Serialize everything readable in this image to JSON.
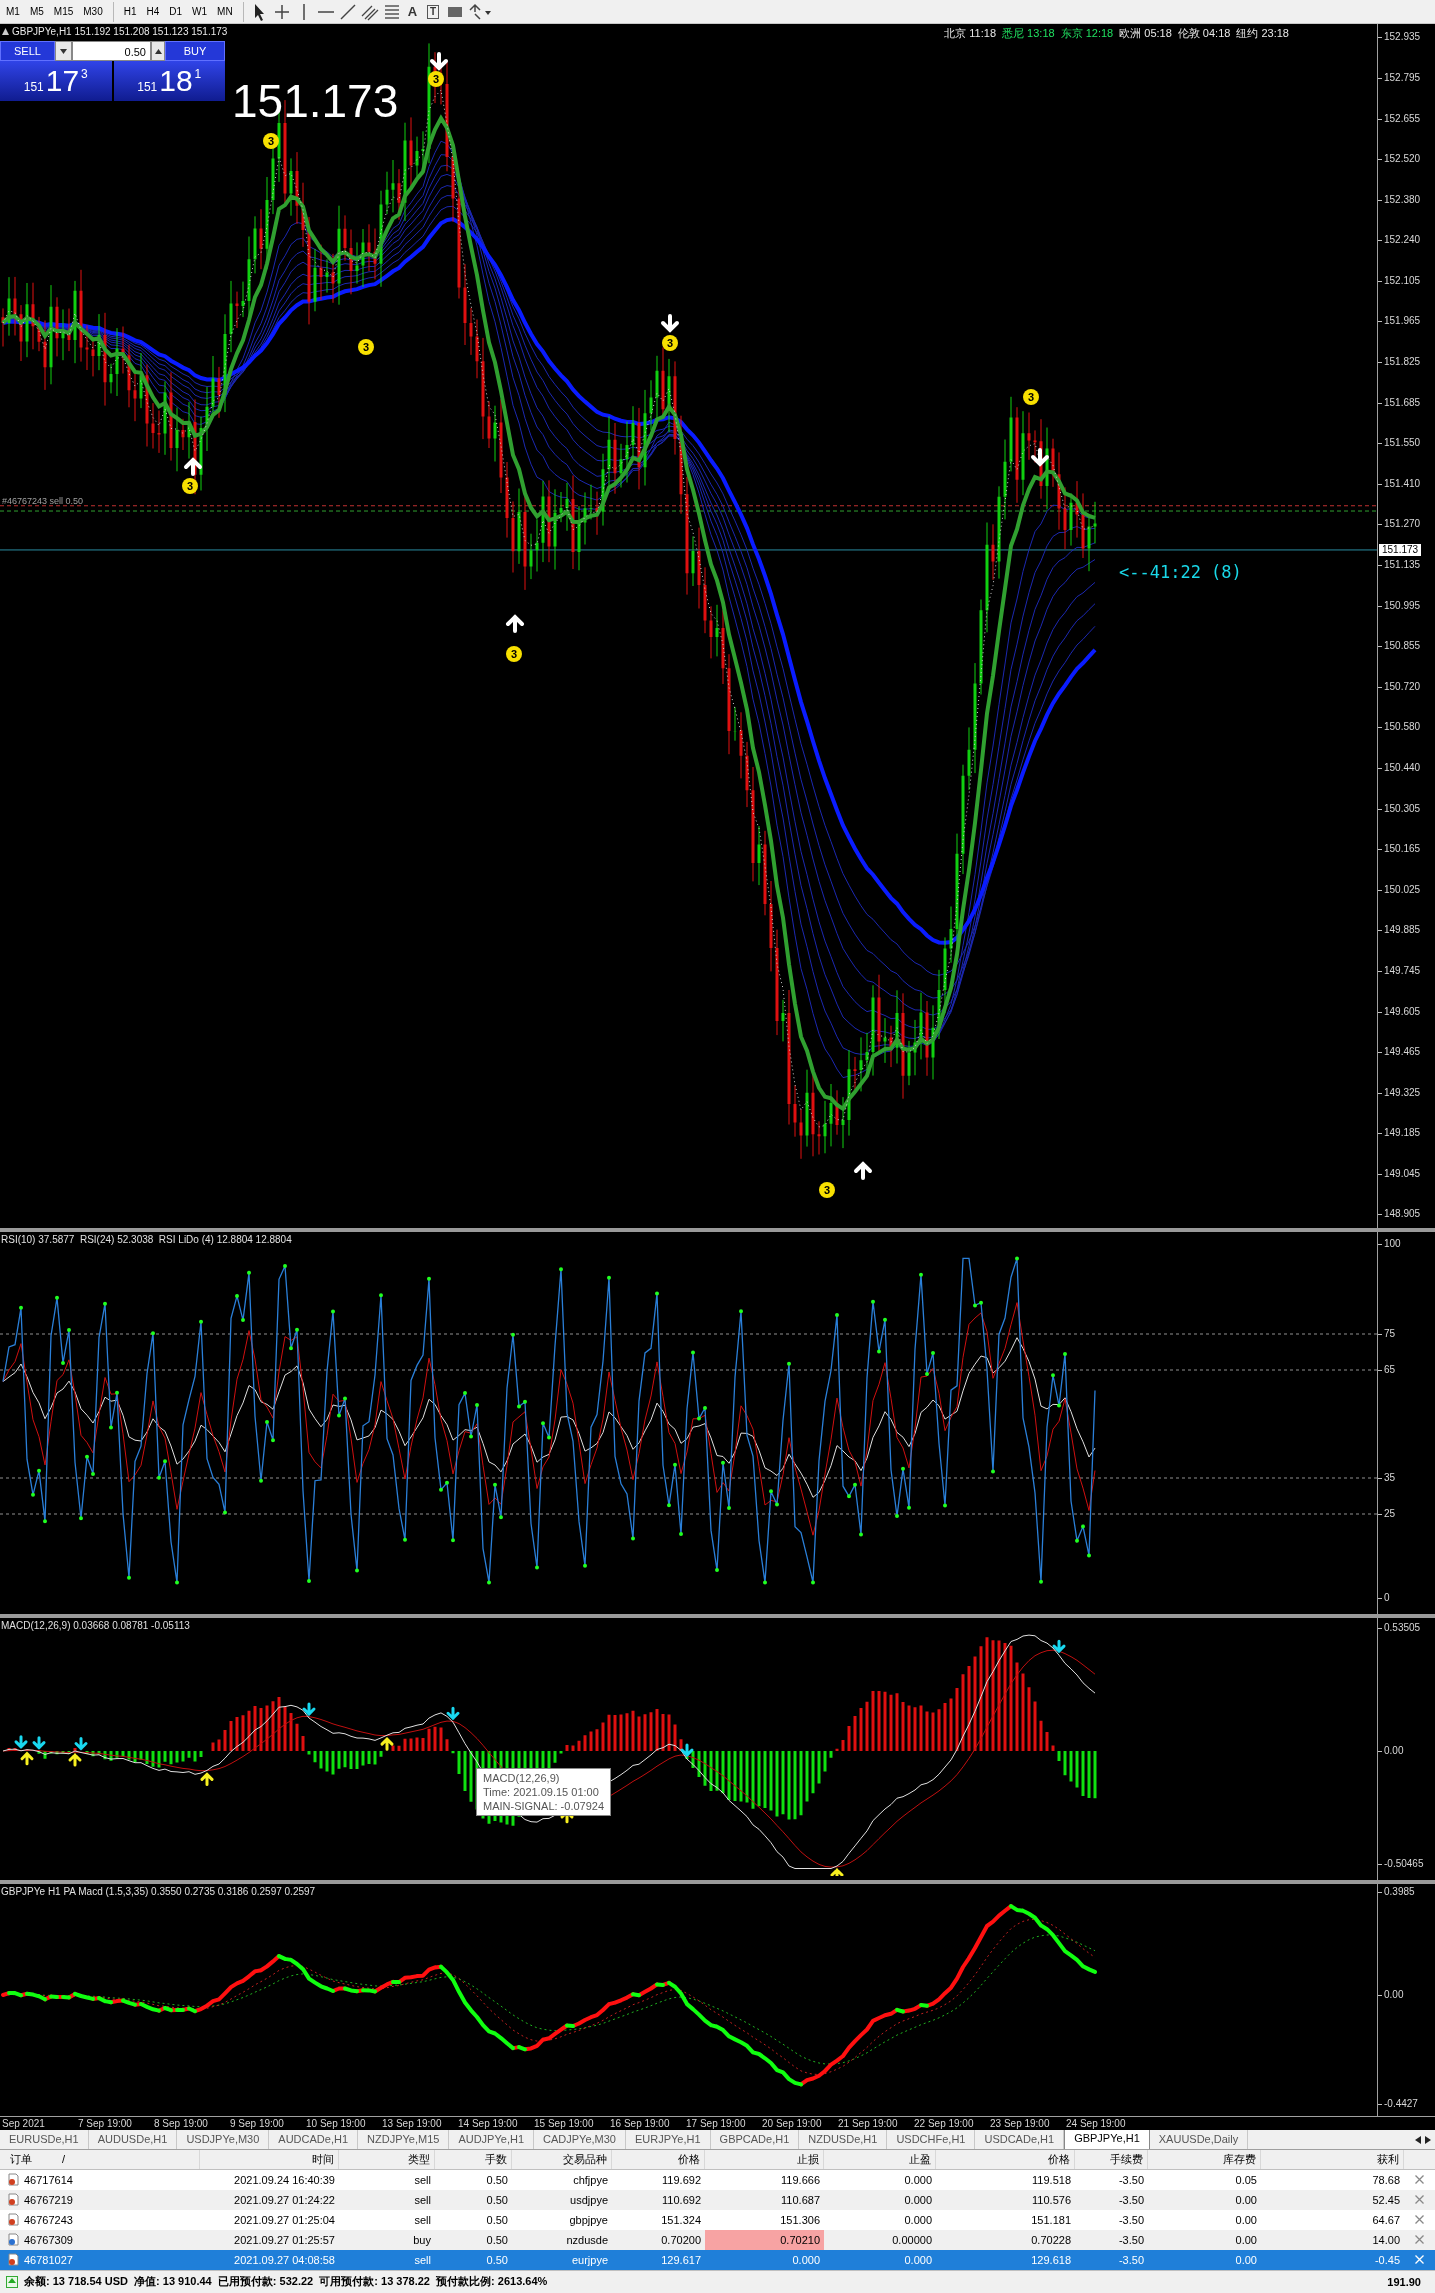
{
  "toolbar": {
    "timeframes": [
      "M1",
      "M5",
      "M15",
      "M30",
      "H1",
      "H4",
      "D1",
      "W1",
      "MN"
    ],
    "text_tool": "A",
    "label_tool": "T"
  },
  "chart": {
    "symbol_line": "GBPJPYe,H1 151.192 151.208 151.123 151.173",
    "clocks": [
      {
        "city": "北京",
        "time": "11:18",
        "market_open": false
      },
      {
        "city": "悉尼",
        "time": "13:18",
        "market_open": true
      },
      {
        "city": "东京",
        "time": "12:18",
        "market_open": true
      },
      {
        "city": "欧洲",
        "time": "05:18",
        "market_open": false
      },
      {
        "city": "伦敦",
        "time": "04:18",
        "market_open": false
      },
      {
        "city": "纽约",
        "time": "23:18",
        "market_open": false
      }
    ],
    "trade_panel": {
      "sell_label": "SELL",
      "buy_label": "BUY",
      "lot": "0.50",
      "sell_price": {
        "prefix": "151",
        "main": "17",
        "pip": "3"
      },
      "buy_price": {
        "prefix": "151",
        "main": "18",
        "pip": "1"
      }
    },
    "last_price": "151.173",
    "order_line_label": "#46767243 sell 0.50",
    "countdown": "<--41:22 (8)",
    "signal_badges": [
      "3",
      "3",
      "3",
      "3",
      "3",
      "3",
      "3",
      "3"
    ],
    "price_axis": [
      "152.935",
      "152.795",
      "152.655",
      "152.520",
      "152.380",
      "152.240",
      "152.105",
      "151.965",
      "151.825",
      "151.685",
      "151.550",
      "151.410",
      "151.270",
      "151.135",
      "150.995",
      "150.855",
      "150.720",
      "150.580",
      "150.440",
      "150.305",
      "150.165",
      "150.025",
      "149.885",
      "149.745",
      "149.605",
      "149.465",
      "149.325",
      "149.185",
      "149.045",
      "148.905"
    ],
    "current_price_tag": "151.173"
  },
  "rsi": {
    "legend": "RSI(10) 37.5877  RSI(24) 52.3038  RSI LiDo (4) 12.8804 12.8804",
    "axis": [
      "100",
      "75",
      "65",
      "35",
      "25",
      "0"
    ]
  },
  "macd": {
    "legend": "MACD(12,26,9) 0.03668 0.08781 -0.05113",
    "axis": [
      "0.53505",
      "0.00",
      "-0.50465"
    ],
    "tooltip": [
      "MACD(12,26,9)",
      "Time: 2021.09.15 01:00",
      "MAIN-SIGNAL: -0.07924"
    ]
  },
  "pa_macd": {
    "legend": "GBPJPYe H1 PA Macd (1.5,3,35) 0.3550 0.2735 0.3186 0.2597 0.2597",
    "axis": [
      "0.3985",
      "0.00",
      "-0.4427"
    ]
  },
  "time_axis": [
    "Sep 2021",
    "7 Sep 19:00",
    "8 Sep 19:00",
    "9 Sep 19:00",
    "10 Sep 19:00",
    "13 Sep 19:00",
    "14 Sep 19:00",
    "15 Sep 19:00",
    "16 Sep 19:00",
    "17 Sep 19:00",
    "20 Sep 19:00",
    "21 Sep 19:00",
    "22 Sep 19:00",
    "23 Sep 19:00",
    "24 Sep 19:00"
  ],
  "tabs": [
    {
      "label": "EURUSDe,H1",
      "selected": false
    },
    {
      "label": "AUDUSDe,H1",
      "selected": false
    },
    {
      "label": "USDJPYe,M30",
      "selected": false
    },
    {
      "label": "AUDCADe,H1",
      "selected": false
    },
    {
      "label": "NZDJPYe,M15",
      "selected": false
    },
    {
      "label": "AUDJPYe,H1",
      "selected": false
    },
    {
      "label": "CADJPYe,M30",
      "selected": false
    },
    {
      "label": "EURJPYe,H1",
      "selected": false
    },
    {
      "label": "GBPCADe,H1",
      "selected": false
    },
    {
      "label": "NZDUSDe,H1",
      "selected": false
    },
    {
      "label": "USDCHFe,H1",
      "selected": false
    },
    {
      "label": "USDCADe,H1",
      "selected": false
    },
    {
      "label": "GBPJPYe,H1",
      "selected": true
    },
    {
      "label": "XAUUSDe,Daily",
      "selected": false
    }
  ],
  "orders": {
    "sort_mark": "/",
    "columns": [
      "订单",
      "时间",
      "类型",
      "手数",
      "交易品种",
      "价格",
      "止损",
      "止盈",
      "价格",
      "手续费",
      "库存费",
      "获利"
    ],
    "rows": [
      {
        "cells": [
          "46717614",
          "2021.09.24 16:40:39",
          "sell",
          "0.50",
          "chfjpye",
          "119.692",
          "119.666",
          "0.000",
          "119.518",
          "-3.50",
          "0.05",
          "78.68"
        ],
        "selected": false,
        "sl_alert": false
      },
      {
        "cells": [
          "46767219",
          "2021.09.27 01:24:22",
          "sell",
          "0.50",
          "usdjpye",
          "110.692",
          "110.687",
          "0.000",
          "110.576",
          "-3.50",
          "0.00",
          "52.45"
        ],
        "selected": false,
        "sl_alert": false
      },
      {
        "cells": [
          "46767243",
          "2021.09.27 01:25:04",
          "sell",
          "0.50",
          "gbpjpye",
          "151.324",
          "151.306",
          "0.000",
          "151.181",
          "-3.50",
          "0.00",
          "64.67"
        ],
        "selected": false,
        "sl_alert": false
      },
      {
        "cells": [
          "46767309",
          "2021.09.27 01:25:57",
          "buy",
          "0.50",
          "nzdusde",
          "0.70200",
          "0.70210",
          "0.00000",
          "0.70228",
          "-3.50",
          "0.00",
          "14.00"
        ],
        "selected": false,
        "sl_alert": true
      },
      {
        "cells": [
          "46781027",
          "2021.09.27 04:08:58",
          "sell",
          "0.50",
          "eurjpye",
          "129.617",
          "0.000",
          "0.000",
          "129.618",
          "-3.50",
          "0.00",
          "-0.45"
        ],
        "selected": true,
        "sl_alert": false
      }
    ]
  },
  "status": {
    "summary": "余额: 13 718.54 USD  净值: 13 910.44  已用预付款: 532.22  可用预付款: 13 378.22  预付款比例: 2613.64%",
    "profit": "191.90"
  }
}
